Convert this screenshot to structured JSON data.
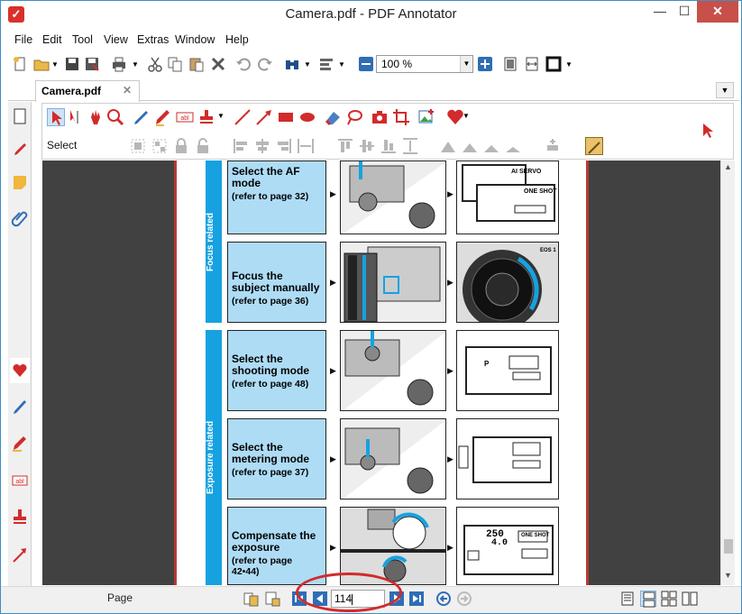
{
  "window": {
    "title": "Camera.pdf - PDF Annotator",
    "controls": [
      "minimize",
      "maximize",
      "close"
    ]
  },
  "menu": [
    "File",
    "Edit",
    "Tool",
    "View",
    "Extras",
    "Window",
    "Help"
  ],
  "toolbar": {
    "zoom_value": "100 %"
  },
  "tabs": {
    "active": "Camera.pdf",
    "close_glyph": "✕"
  },
  "annotation_toolbar": {
    "select_label": "Select"
  },
  "document": {
    "sections": [
      {
        "label": "Focus related"
      },
      {
        "label": "Exposure related"
      }
    ],
    "rows": [
      {
        "title": "Select the AF mode",
        "ref": "(refer to page 32)",
        "lcd1": "AI SERVO",
        "lcd2": "ONE SHOT"
      },
      {
        "title": "Focus the subject manually",
        "ref": "(refer to page 36)",
        "lcd1": "EOS 1"
      },
      {
        "title": "Select the shooting mode",
        "ref": "(refer to page 48)",
        "lcd1": "P"
      },
      {
        "title": "Select the metering mode",
        "ref": "(refer to page 37)"
      },
      {
        "title": "Compensate the exposure",
        "ref": "(refer to page 42•44)",
        "lcd1": "250",
        "lcd2": "4.0",
        "lcd3": "ONE SHOT"
      }
    ]
  },
  "status": {
    "label": "Page",
    "page_number": "114"
  },
  "colors": {
    "accent_blue": "#16a2e0",
    "annotation_red": "#d22b2b",
    "page_border": "#b63a33",
    "viewport_bg": "#414141"
  }
}
